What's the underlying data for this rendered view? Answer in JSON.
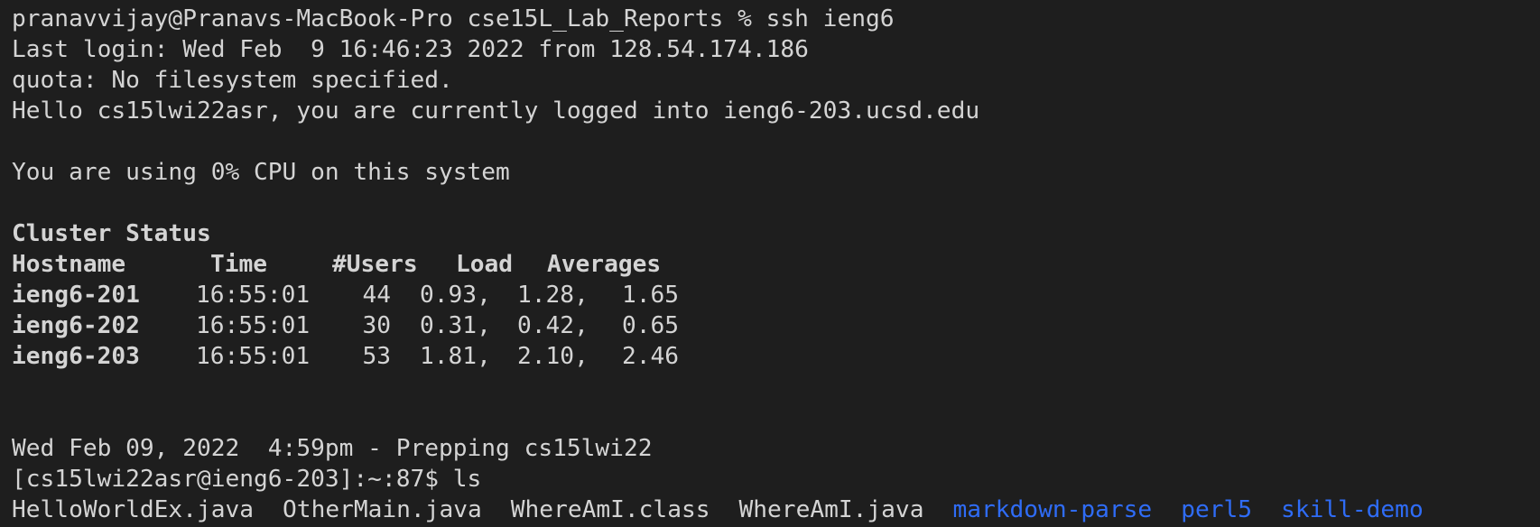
{
  "terminal": {
    "prompt_line": "pranavvijay@Pranavs-MacBook-Pro cse15L_Lab_Reports % ssh ieng6",
    "last_login": "Last login: Wed Feb  9 16:46:23 2022 from 128.54.174.186",
    "quota": "quota: No filesystem specified.",
    "hello": "Hello cs15lwi22asr, you are currently logged into ieng6-203.ucsd.edu",
    "cpu": "You are using 0% CPU on this system",
    "cluster_title": "Cluster Status",
    "table_headers": [
      "Hostname",
      "Time",
      "#Users",
      "Load",
      "Averages"
    ],
    "table_rows": [
      {
        "host": "ieng6-201",
        "time": "16:55:01",
        "users": "44",
        "load1": "0.93,",
        "load2": "1.28,",
        "load3": "1.65"
      },
      {
        "host": "ieng6-202",
        "time": "16:55:01",
        "users": "30",
        "load1": "0.31,",
        "load2": "0.42,",
        "load3": "0.65"
      },
      {
        "host": "ieng6-203",
        "time": "16:55:01",
        "users": "53",
        "load1": "1.81,",
        "load2": "2.10,",
        "load3": "2.46"
      }
    ],
    "prepping": "Wed Feb 09, 2022  4:59pm - Prepping cs15lwi22",
    "shell_prompt": "[cs15lwi22asr@ieng6-203]:~:87$ ls",
    "ls_files": [
      "HelloWorldEx.java",
      "OtherMain.java",
      "WhereAmI.class",
      "WhereAmI.java"
    ],
    "ls_dirs": [
      "markdown-parse",
      "perl5",
      "skill-demo"
    ],
    "colors": {
      "background": "#1e1e1e",
      "text": "#d4d4d4",
      "directory": "#2f6cf6"
    }
  }
}
